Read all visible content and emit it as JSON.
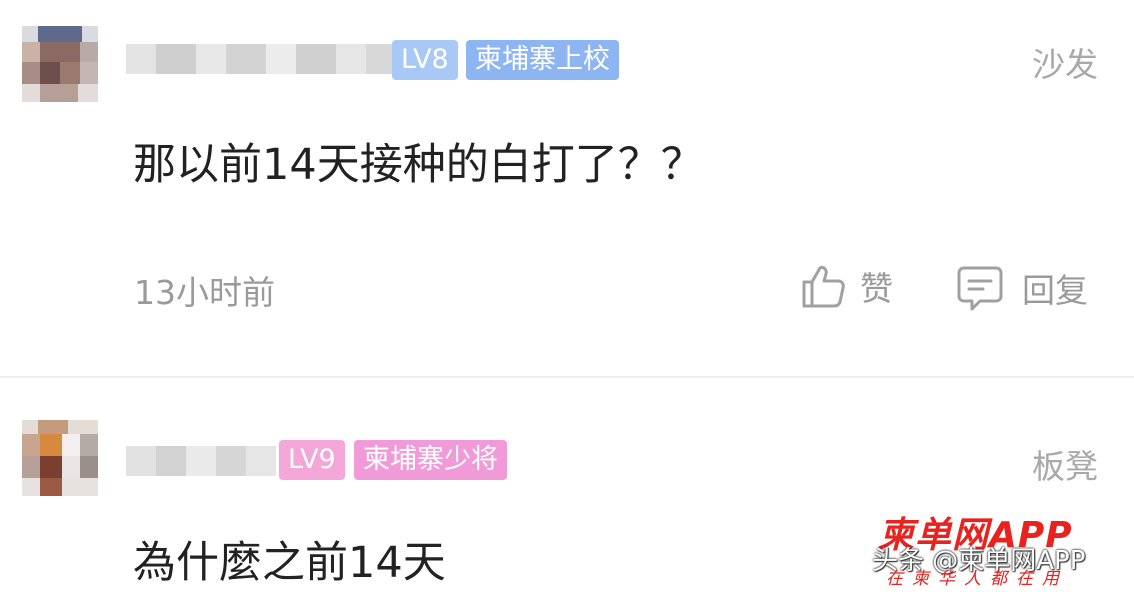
{
  "comments": [
    {
      "level_badge": "LV8",
      "rank_badge": "柬埔寨上校",
      "floor": "沙发",
      "text": "那以前14天接种的白打了？？",
      "time": "13小时前",
      "like_label": "赞",
      "reply_label": "回复",
      "level_color": "#a8c8f5",
      "rank_color": "#8db5f2"
    },
    {
      "level_badge": "LV9",
      "rank_badge": "柬埔寨少将",
      "floor": "板凳",
      "text": "為什麼之前14天"
    }
  ],
  "icons": {
    "like": "thumbs-up-icon",
    "reply": "comment-bubble-icon"
  },
  "watermark": {
    "logo": "柬单网APP",
    "caption": "头条 @柬单网APP",
    "slogan": "在柬华人都在用",
    "color": "#e8231f"
  },
  "colors": {
    "lv9_badge": "#f4a6d8",
    "rank2_badge": "#f19ad8",
    "text_primary": "#222222",
    "text_secondary": "#9a9a9a"
  }
}
